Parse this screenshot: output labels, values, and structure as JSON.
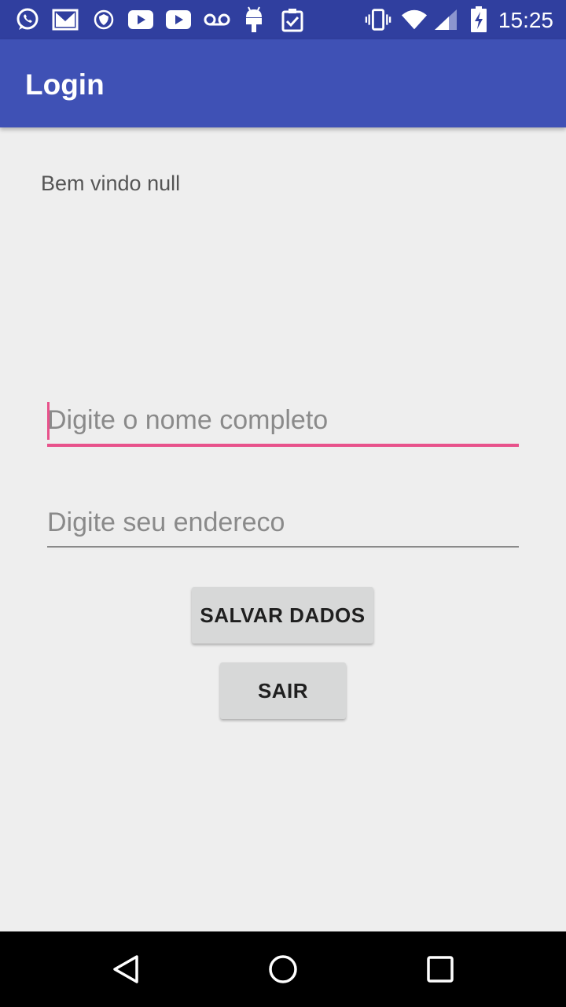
{
  "status_bar": {
    "time": "15:25",
    "left_icons": [
      "whatsapp-icon",
      "gmail-icon",
      "shield-icon",
      "youtube-icon",
      "youtube-icon",
      "voicemail-icon",
      "android-icon",
      "clipboard-check-icon"
    ],
    "right_icons": [
      "vibrate-icon",
      "wifi-icon",
      "signal-icon",
      "battery-charging-icon"
    ]
  },
  "app_bar": {
    "title": "Login"
  },
  "welcome_text": "Bem vindo null",
  "form": {
    "name_placeholder": "Digite o nome completo",
    "name_value": "",
    "address_placeholder": "Digite seu endereco",
    "address_value": "",
    "save_label": "SALVAR DADOS",
    "exit_label": "SAIR"
  },
  "colors": {
    "status_bar": "#303f9f",
    "app_bar": "#3f51b5",
    "accent": "#e8528b",
    "background": "#eeeeee",
    "button": "#d7d8d8"
  },
  "nav_bar": {
    "icons": [
      "back-icon",
      "home-icon",
      "recents-icon"
    ]
  }
}
